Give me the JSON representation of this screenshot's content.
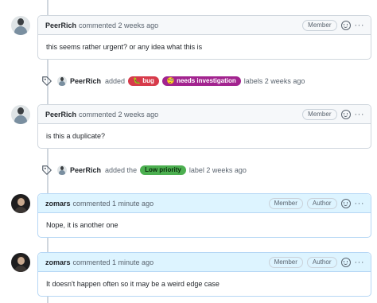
{
  "colors": {
    "label_bug": "#d73a4a",
    "label_investigation": "#a2238f",
    "label_low_priority": "#4caf50",
    "header_highlight": "#ddf4ff"
  },
  "comments": [
    {
      "author": "PeerRich",
      "meta": "commented 2 weeks ago",
      "role": "Member",
      "body": "this seems rather urgent? or any idea what this is"
    },
    {
      "author": "PeerRich",
      "meta": "commented 2 weeks ago",
      "role": "Member",
      "body": "is this a duplicate?"
    },
    {
      "author": "zomars",
      "meta": "commented 1 minute ago",
      "role": "Member",
      "author_badge": "Author",
      "body": "Nope, it is another one"
    },
    {
      "author": "zomars",
      "meta": "commented 1 minute ago",
      "role": "Member",
      "author_badge": "Author",
      "body": "It doesn't happen often so it may be a weird edge case"
    }
  ],
  "events": [
    {
      "actor": "PeerRich",
      "verb": "added",
      "labels": [
        "🐛 bug",
        "🧐 needs investigation"
      ],
      "suffix": "labels 2 weeks ago"
    },
    {
      "actor": "PeerRich",
      "verb": "added the",
      "labels": [
        "Low priority"
      ],
      "suffix": "label 2 weeks ago"
    }
  ],
  "icons": {
    "reaction": "smiley-icon",
    "more": "kebab-icon",
    "event": "tag-icon"
  }
}
